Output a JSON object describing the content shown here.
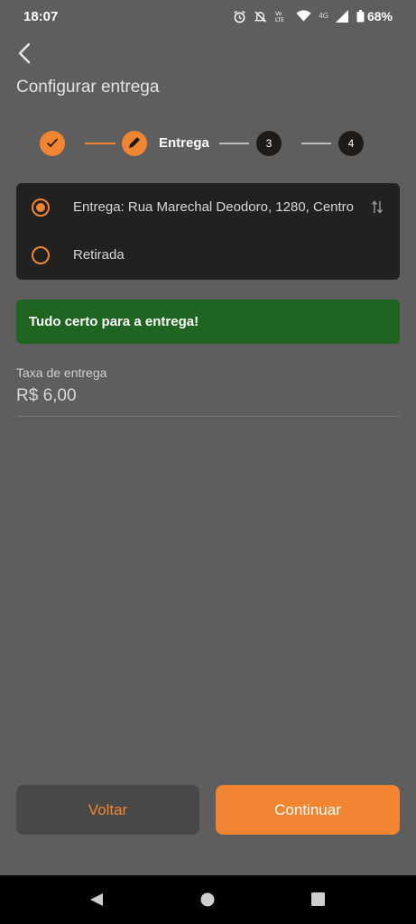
{
  "status_bar": {
    "time": "18:07",
    "battery": "68%",
    "network": "4G",
    "icons": [
      "alarm-icon",
      "mute-icon",
      "volte-icon",
      "wifi-icon",
      "signal-icon",
      "battery-icon"
    ]
  },
  "header": {
    "title": "Configurar entrega",
    "back_icon": "chevron-left-icon"
  },
  "stepper": {
    "steps": [
      {
        "state": "done",
        "icon": "check-icon"
      },
      {
        "state": "active",
        "icon": "pencil-icon",
        "label": "Entrega"
      },
      {
        "state": "pending",
        "number": "3"
      },
      {
        "state": "pending",
        "number": "4"
      }
    ]
  },
  "delivery_options": [
    {
      "label": "Entrega: Rua Marechal Deodoro, 1280, Centro",
      "selected": true,
      "icon": "swap-vertical-icon"
    },
    {
      "label": "Retirada",
      "selected": false
    }
  ],
  "banner": {
    "text": "Tudo certo para a entrega!"
  },
  "fee": {
    "label": "Taxa de entrega",
    "value": "R$ 6,00"
  },
  "buttons": {
    "back": "Voltar",
    "next": "Continuar"
  },
  "colors": {
    "accent": "#f28532",
    "background": "#5e5e5e",
    "card": "#212121",
    "success": "#1f6521"
  }
}
